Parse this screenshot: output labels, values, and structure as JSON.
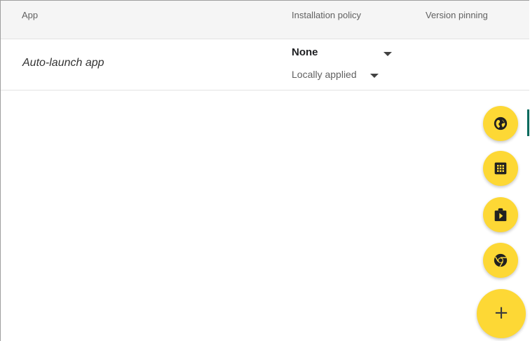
{
  "table": {
    "headers": {
      "app": "App",
      "installation_policy": "Installation policy",
      "version_pinning": "Version pinning"
    },
    "rows": [
      {
        "app_name": "Auto-launch app",
        "installation_policy": "None",
        "policy_scope": "Locally applied"
      }
    ]
  },
  "fab_menu": {
    "items": [
      {
        "icon": "globe-icon"
      },
      {
        "icon": "apps-grid-icon"
      },
      {
        "icon": "play-store-icon"
      },
      {
        "icon": "chrome-icon"
      }
    ],
    "main_button": {
      "icon": "add-icon",
      "label": "+"
    }
  },
  "colors": {
    "fab_background": "#fdd835",
    "icon_color": "#212121",
    "header_background": "#f5f5f5",
    "marker": "#00695c"
  }
}
